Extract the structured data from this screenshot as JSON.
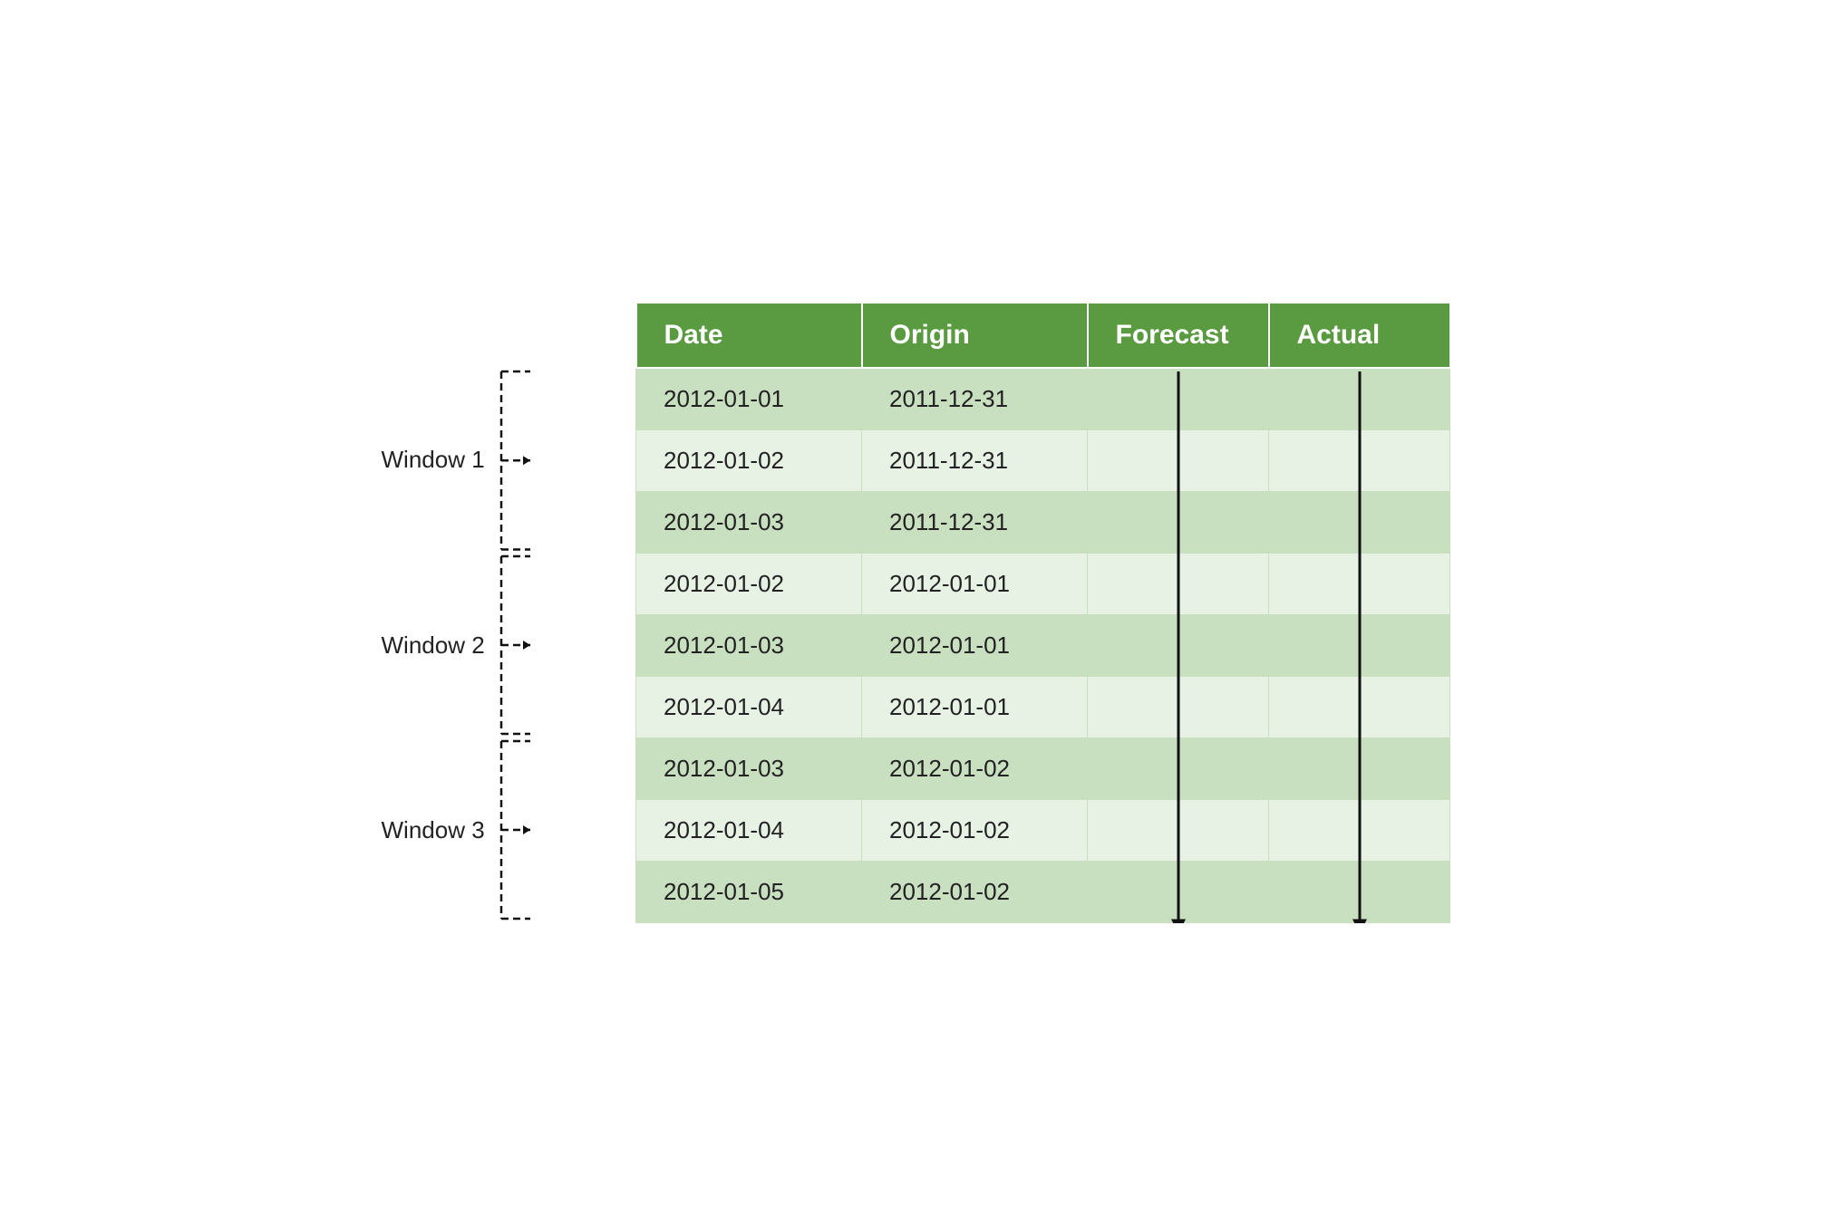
{
  "header": {
    "date_col": "Date",
    "origin_col": "Origin",
    "forecast_col": "Forecast",
    "actual_col": "Actual"
  },
  "windows": [
    {
      "label": "Window 1",
      "rows": [
        {
          "date": "2012-01-01",
          "origin": "2011-12-31",
          "shade": "dark"
        },
        {
          "date": "2012-01-02",
          "origin": "2011-12-31",
          "shade": "light"
        },
        {
          "date": "2012-01-03",
          "origin": "2011-12-31",
          "shade": "dark"
        }
      ]
    },
    {
      "label": "Window 2",
      "rows": [
        {
          "date": "2012-01-02",
          "origin": "2012-01-01",
          "shade": "light"
        },
        {
          "date": "2012-01-03",
          "origin": "2012-01-01",
          "shade": "dark"
        },
        {
          "date": "2012-01-04",
          "origin": "2012-01-01",
          "shade": "light"
        }
      ]
    },
    {
      "label": "Window 3",
      "rows": [
        {
          "date": "2012-01-03",
          "origin": "2012-01-02",
          "shade": "dark"
        },
        {
          "date": "2012-01-04",
          "origin": "2012-01-02",
          "shade": "light"
        },
        {
          "date": "2012-01-05",
          "origin": "2012-01-02",
          "shade": "dark"
        }
      ]
    }
  ],
  "colors": {
    "header_bg": "#5a9a40",
    "header_text": "#ffffff",
    "row_dark": "#c8dfc0",
    "row_light": "#e8f2e4",
    "border": "#c8dfc0",
    "arrow": "#111111",
    "bracket": "#111111",
    "text": "#222222"
  }
}
